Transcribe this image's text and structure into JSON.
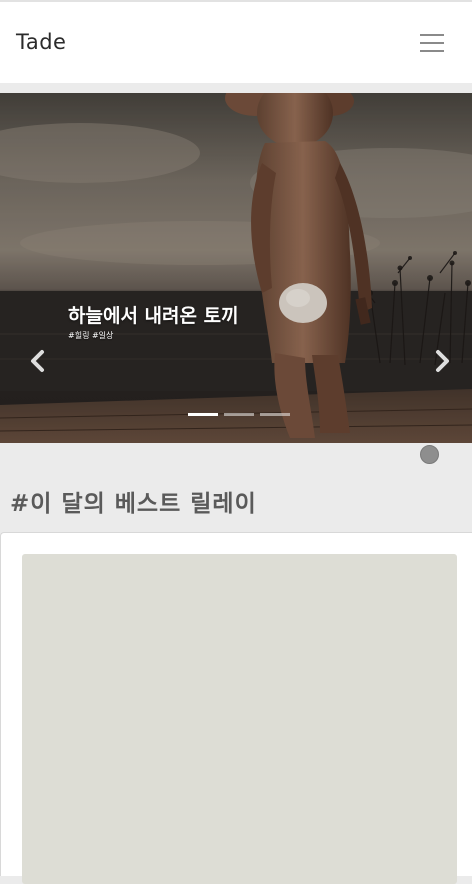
{
  "navbar": {
    "brand": "Tade",
    "menu_icon": "hamburger-menu-icon"
  },
  "carousel": {
    "slides": [
      {
        "title": "하늘에서 내려온 토끼",
        "tags": "#힐링 #일상",
        "image": "person-in-rabbit-costume-at-dusk"
      }
    ],
    "active_index": 0,
    "slide_count": 3,
    "prev_icon": "chevron-left-icon",
    "next_icon": "chevron-right-icon"
  },
  "section": {
    "title": "#이 달의 베스트 릴레이"
  },
  "colors": {
    "page_background": "#ebebeb",
    "navbar_background": "#ffffff",
    "card_placeholder": "#ddddd5",
    "section_title": "#5a5a5a"
  }
}
